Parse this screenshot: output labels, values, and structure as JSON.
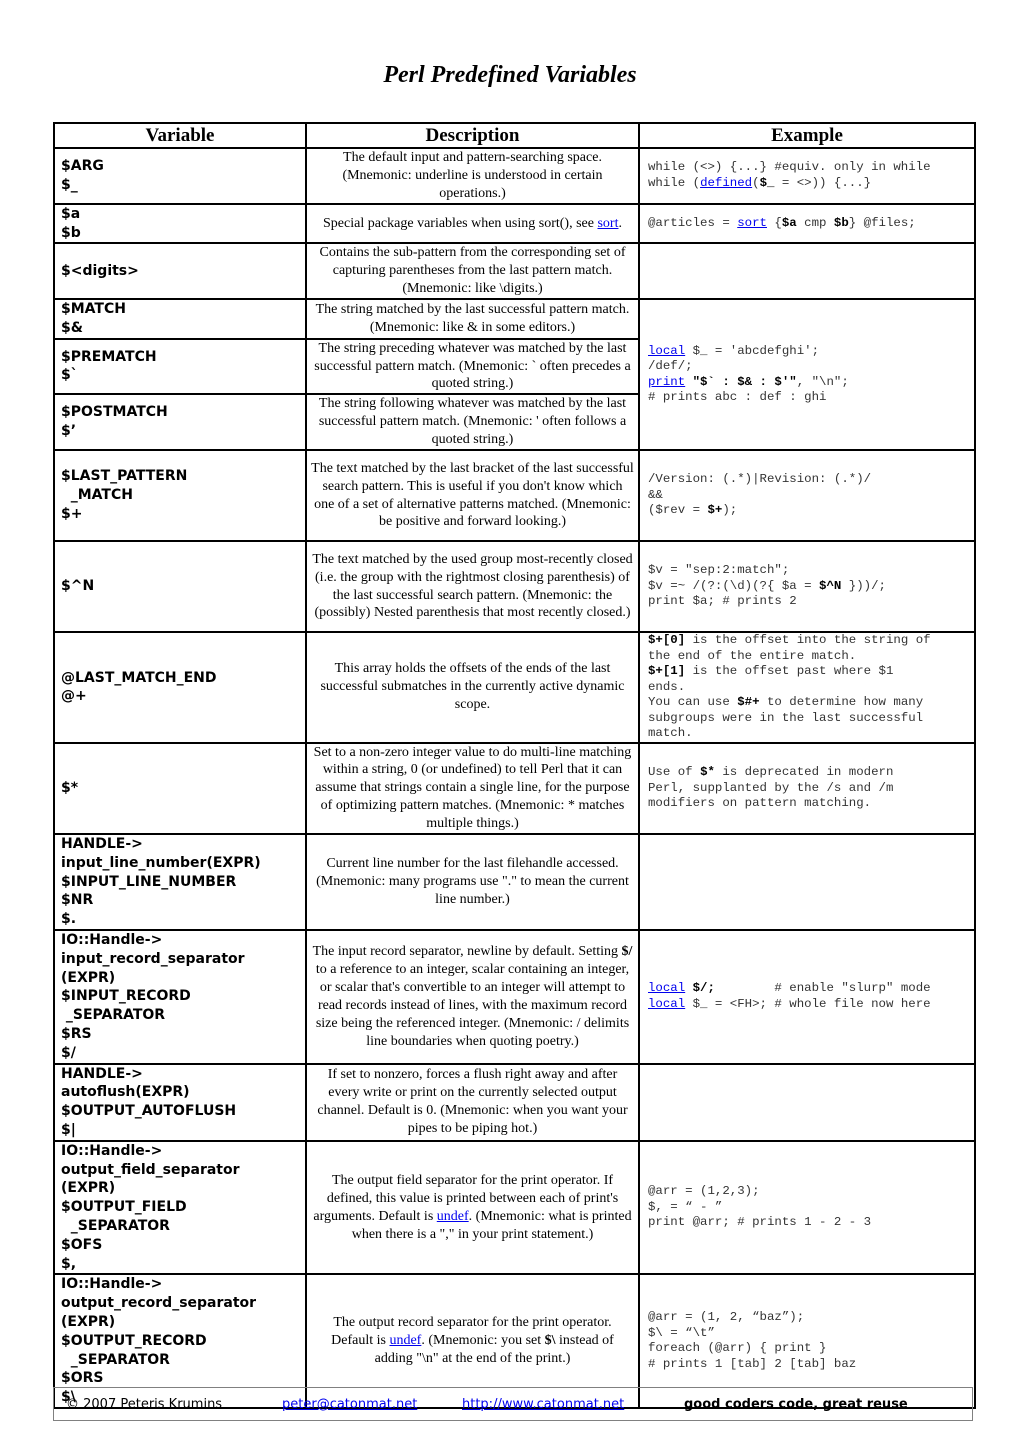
{
  "document": {
    "title": "Perl Predefined Variables"
  },
  "table": {
    "headers": [
      "Variable",
      "Description",
      "Example"
    ],
    "rows": [
      {
        "variable_lines": [
          "$ARG",
          "$_"
        ],
        "description": "The default input and pattern-searching space. (Mnemonic: underline is understood in certain operations.)",
        "example_lines": [
          [
            {
              "t": "while (<>) {...} #equiv. only in while"
            }
          ],
          [
            {
              "t": "while ("
            },
            {
              "t": "defined",
              "link": true
            },
            {
              "t": "("
            },
            {
              "t": "$_",
              "bold": true
            },
            {
              "t": " = <>)) {...}"
            }
          ]
        ]
      },
      {
        "variable_lines": [
          "$a",
          "$b"
        ],
        "description_parts": [
          {
            "t": "Special package variables when using sort(), see "
          },
          {
            "t": "sort",
            "link": true
          },
          {
            "t": "."
          }
        ],
        "example_lines": [
          [
            {
              "t": "@articles = "
            },
            {
              "t": "sort",
              "link": true
            },
            {
              "t": " {"
            },
            {
              "t": "$a",
              "bold": true
            },
            {
              "t": " cmp "
            },
            {
              "t": "$b",
              "bold": true
            },
            {
              "t": "} @files;"
            }
          ]
        ]
      },
      {
        "variable_lines": [
          "$<digits>"
        ],
        "description": "Contains the sub-pattern from the corresponding set of capturing parentheses from the last pattern match. (Mnemonic: like \\digits.)",
        "example_lines": []
      },
      {
        "variable_lines": [
          "$MATCH",
          "$&"
        ],
        "description": "The string matched by the last successful pattern match. (Mnemonic: like & in some editors.)",
        "example_lines": [
          [
            {
              "t": "local",
              "link": true
            },
            {
              "t": " $_ = 'abcdefghi';"
            }
          ],
          [
            {
              "t": "/def/;"
            }
          ],
          [
            {
              "t": "print",
              "link": true
            },
            {
              "t": " "
            },
            {
              "t": "\"$` : $& : $'\"",
              "bold": true
            },
            {
              "t": ", \"\\n\";"
            }
          ],
          [
            {
              "t": "# prints abc : def : ghi"
            }
          ]
        ],
        "example_rowspan": 3
      },
      {
        "variable_lines": [
          "$PREMATCH",
          "$`"
        ],
        "description": "The string preceding whatever was matched by the last successful pattern match. (Mnemonic: ` often precedes a quoted string.)"
      },
      {
        "variable_lines": [
          "$POSTMATCH",
          "$’"
        ],
        "description": "The string following whatever was matched by the last successful pattern match. (Mnemonic: ' often follows a quoted string.)"
      },
      {
        "variable_lines": [
          "$LAST_PATTERN",
          "  _MATCH",
          "$+"
        ],
        "description": "The text matched by the last bracket of the last successful search pattern. This is useful if you don't know which one of a set of alternative patterns matched. (Mnemonic: be positive and forward looking.)",
        "example_lines": [
          [
            {
              "t": "/Version: (.*)|Revision: (.*)/"
            }
          ],
          [
            {
              "t": "&&"
            }
          ],
          [
            {
              "t": "($rev = "
            },
            {
              "t": "$+",
              "bold": true
            },
            {
              "t": ");"
            }
          ]
        ]
      },
      {
        "variable_lines": [
          "$^N"
        ],
        "description": "The text matched by the used group most-recently closed (i.e. the group with the rightmost closing parenthesis) of the last successful search pattern. (Mnemonic: the (possibly) Nested parenthesis that most recently closed.)",
        "example_lines": [
          [
            {
              "t": "$v = \"sep:2:match\";"
            }
          ],
          [
            {
              "t": "$v =~ /(?:(\\d)(?{ $a = "
            },
            {
              "t": "$^N",
              "bold": true
            },
            {
              "t": " }))/;"
            }
          ],
          [
            {
              "t": "print $a; # prints 2"
            }
          ]
        ]
      },
      {
        "variable_lines": [
          "@LAST_MATCH_END",
          "@+"
        ],
        "description": "This array holds the offsets of the ends of the last successful submatches in the currently active dynamic scope.",
        "example_lines": [
          [
            {
              "t": "$+[0]",
              "bold": true
            },
            {
              "t": " is the offset into the string of"
            }
          ],
          [
            {
              "t": "the end of the entire match."
            }
          ],
          [
            {
              "t": "$+[1]",
              "bold": true
            },
            {
              "t": " is the offset past where $1"
            }
          ],
          [
            {
              "t": "ends."
            }
          ],
          [
            {
              "t": "You can use "
            },
            {
              "t": "$#+",
              "bold": true
            },
            {
              "t": " to determine how many"
            }
          ],
          [
            {
              "t": "subgroups were in the last successful"
            }
          ],
          [
            {
              "t": "match."
            }
          ]
        ]
      },
      {
        "variable_lines": [
          "$*"
        ],
        "description": "Set to a non-zero integer value to do multi-line matching within a string, 0 (or undefined) to tell Perl that it can assume that strings contain a single line, for the purpose of optimizing pattern matches. (Mnemonic: * matches multiple things.)",
        "example_lines": [
          [
            {
              "t": "Use of "
            },
            {
              "t": "$*",
              "bold": true
            },
            {
              "t": " is deprecated in modern"
            }
          ],
          [
            {
              "t": "Perl, supplanted by the /s and /m"
            }
          ],
          [
            {
              "t": "modifiers on pattern matching."
            }
          ]
        ]
      },
      {
        "variable_lines": [
          "HANDLE->",
          "input_line_number(EXPR)",
          "$INPUT_LINE_NUMBER",
          "$NR",
          "$."
        ],
        "description": "Current line number for the last filehandle accessed. (Mnemonic: many programs use \".\" to mean the current line number.)",
        "example_lines": []
      },
      {
        "variable_lines": [
          "IO::Handle->",
          "input_record_separator",
          "(EXPR)",
          "$INPUT_RECORD",
          " _SEPARATOR",
          "$RS",
          "$/"
        ],
        "description_parts": [
          {
            "t": "The input record separator, newline by default. Setting "
          },
          {
            "t": "$/",
            "bold": true
          },
          {
            "t": " to a reference to an integer, scalar containing an integer, or scalar that's convertible to an integer will attempt to read records instead of lines, with the maximum record size being the referenced integer. (Mnemonic: / delimits line boundaries when quoting poetry.)"
          }
        ],
        "example_lines": [
          [
            {
              "t": "local",
              "link": true
            },
            {
              "t": " "
            },
            {
              "t": "$/;",
              "bold": true
            },
            {
              "t": "        # enable \"slurp\" mode"
            }
          ],
          [
            {
              "t": "local",
              "link": true
            },
            {
              "t": " $_ = <FH>; # whole file now here"
            }
          ]
        ]
      },
      {
        "variable_lines": [
          "HANDLE->",
          "autoflush(EXPR)",
          "$OUTPUT_AUTOFLUSH",
          "$|"
        ],
        "description": "If set to nonzero, forces a flush right away and after every write or print on the currently selected output channel. Default is 0. (Mnemonic: when you want your pipes to be piping hot.)",
        "example_lines": []
      },
      {
        "variable_lines": [
          "IO::Handle->",
          "output_field_separator",
          "(EXPR)",
          "$OUTPUT_FIELD",
          "  _SEPARATOR",
          "$OFS",
          "$,"
        ],
        "description_parts": [
          {
            "t": "The output field separator for the print operator. If defined, this value is printed between each of print's arguments. Default is "
          },
          {
            "t": "undef",
            "link": true
          },
          {
            "t": ". (Mnemonic: what is printed when there is a \",\" in your print statement.)"
          }
        ],
        "example_lines": [
          [
            {
              "t": "@arr = (1,2,3);"
            }
          ],
          [
            {
              "t": "$, = “ - ”"
            }
          ],
          [
            {
              "t": "print @arr; # prints 1 - 2 - 3"
            }
          ]
        ]
      },
      {
        "variable_lines": [
          "IO::Handle->",
          "output_record_separator",
          "(EXPR)",
          "$OUTPUT_RECORD",
          "  _SEPARATOR",
          "$ORS",
          "$\\"
        ],
        "description_parts": [
          {
            "t": "The output record separator for the print operator. Default is "
          },
          {
            "t": "undef",
            "link": true
          },
          {
            "t": ". (Mnemonic: you set "
          },
          {
            "t": "$\\",
            "bold": true
          },
          {
            "t": " instead of adding \"\\n\" at the end of the print.)"
          }
        ],
        "example_lines": [
          [
            {
              "t": "@arr = (1, 2, “baz”);"
            }
          ],
          [
            {
              "t": "$\\ = “\\t”"
            }
          ],
          [
            {
              "t": "foreach (@arr) { print }"
            }
          ],
          [
            {
              "t": "# prints 1 [tab] 2 [tab] baz"
            }
          ]
        ]
      }
    ]
  },
  "footer": {
    "copyright": "© 2007 Peteris Krumins",
    "email": "peter@catonmat.net",
    "url": "http://www.catonmat.net",
    "motto": "good coders code, great reuse"
  },
  "colors": {
    "link": "#0000ee",
    "code_text": "#333333",
    "border": "#000000",
    "footer_border": "#808080"
  }
}
